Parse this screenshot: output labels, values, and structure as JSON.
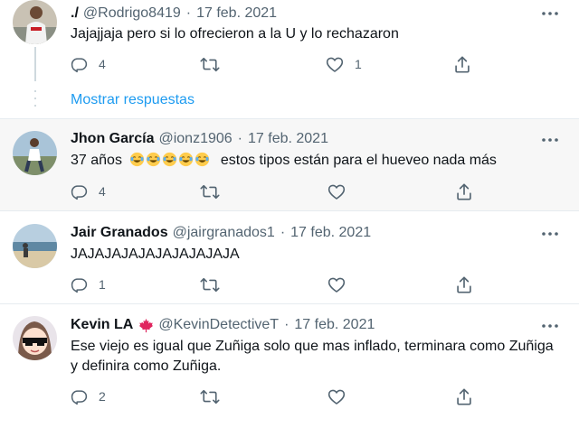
{
  "tweets": [
    {
      "name": "./",
      "handle": "@Rodrigo8419",
      "dot": "·",
      "date": "17 feb. 2021",
      "text": "Jajajjaja pero si lo ofrecieron a la U y lo rechazaron",
      "replies": "4",
      "retweets": "",
      "likes": "1"
    },
    {
      "name": "Jhon García",
      "handle": "@ionz1906",
      "dot": "·",
      "date": "17 feb. 2021",
      "text_prefix": "37 años",
      "text_suffix": "estos tipos están para el hueveo nada más",
      "emoji_count": 5,
      "replies": "4",
      "retweets": "",
      "likes": ""
    },
    {
      "name": "Jair Granados",
      "handle": "@jairgranados1",
      "dot": "·",
      "date": "17 feb. 2021",
      "text": "JAJAJAJAJAJAJAJAJAJA",
      "replies": "1",
      "retweets": "",
      "likes": ""
    },
    {
      "name": "Kevin LA",
      "handle": "@KevinDetectiveT",
      "dot": "·",
      "date": "17 feb. 2021",
      "text": "Ese viejo es igual que Zuñiga solo que mas inflado, terminara como Zuñiga y definira como Zuñiga.",
      "replies": "2",
      "retweets": "",
      "likes": ""
    }
  ],
  "show_replies": "Mostrar respuestas",
  "colors": {
    "accent": "#1d9bf0",
    "muted": "#536471",
    "highlight_bg": "#f7f7f7",
    "separator": "#e6ecf0"
  },
  "icons": [
    "reply-icon",
    "retweet-icon",
    "like-icon",
    "share-icon",
    "more-icon",
    "maple-leaf-icon",
    "joy-emoji-icon"
  ]
}
